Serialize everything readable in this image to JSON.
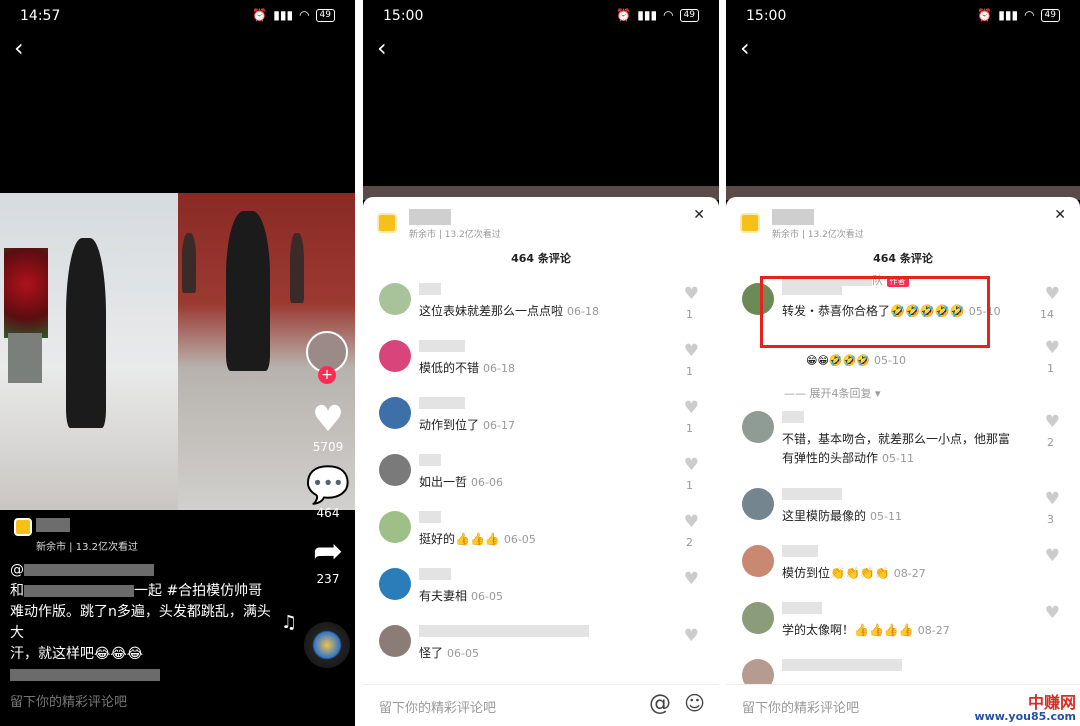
{
  "colors": {
    "accent": "#fe2c55",
    "highlight": "#e5231c",
    "poi": "#f5c018"
  },
  "s1": {
    "time": "14:57",
    "battery": "49",
    "likes": "5709",
    "comments": "464",
    "shares": "237",
    "poi_meta": "新余市 | 13.2亿次看过",
    "caption_at": "@",
    "caption_and": "和",
    "caption_join": "一起 #合拍模仿帅哥",
    "caption_line3": "难动作版。跳了n多遍，头发都跳乱，满头大",
    "caption_line4": "汗，就这样吧😂😂😂",
    "input_placeholder": "留下你的精彩评论吧"
  },
  "s2": {
    "time": "15:00",
    "battery": "49",
    "poi_meta": "新余市 | 13.2亿次看过",
    "count": "464 条评论",
    "comments": [
      {
        "text": "这位表妹就差那么一点点啦",
        "date": "06-18",
        "likes": "1"
      },
      {
        "text": "模低的不错",
        "date": "06-18",
        "likes": "1"
      },
      {
        "text": "动作到位了",
        "date": "06-17",
        "likes": "1"
      },
      {
        "text": "如出一哲",
        "date": "06-06",
        "likes": "1"
      },
      {
        "text": "挺好的👍👍👍",
        "date": "06-05",
        "likes": "2"
      },
      {
        "text": "有夫妻相",
        "date": "06-05",
        "likes": ""
      },
      {
        "text": "怪了",
        "date": "06-05",
        "likes": ""
      }
    ],
    "input_placeholder": "留下你的精彩评论吧",
    "at_symbol": "@",
    "emoji_symbol": "☺"
  },
  "s3": {
    "time": "15:00",
    "battery": "49",
    "poi_meta": "新余市 | 13.2亿次看过",
    "count": "464 条评论",
    "top_comment": {
      "text": "转发・恭喜你合格了🤣🤣🤣🤣🤣",
      "date": "05-10",
      "likes": "14"
    },
    "reply": {
      "tail": "队",
      "author_tag": "作者",
      "text": "😁😁🤣🤣🤣",
      "date": "05-10",
      "likes": "1"
    },
    "expand": "—— 展开4条回复 ▾",
    "comments": [
      {
        "text": "不错，基本吻合，就差那么一小点，他那富",
        "text2": "有弹性的头部动作",
        "date": "05-11",
        "likes": "2"
      },
      {
        "text": "这里模防最像的",
        "date": "05-11",
        "likes": "3"
      },
      {
        "text": "模仿到位👏👏👏👏",
        "date": "08-27",
        "likes": ""
      },
      {
        "text": "学的太像啊！👍👍👍👍",
        "date": "08-27",
        "likes": ""
      }
    ],
    "input_placeholder": "留下你的精彩评论吧"
  },
  "watermark": {
    "line1": "中赚网",
    "line2": "www.you85.com"
  }
}
